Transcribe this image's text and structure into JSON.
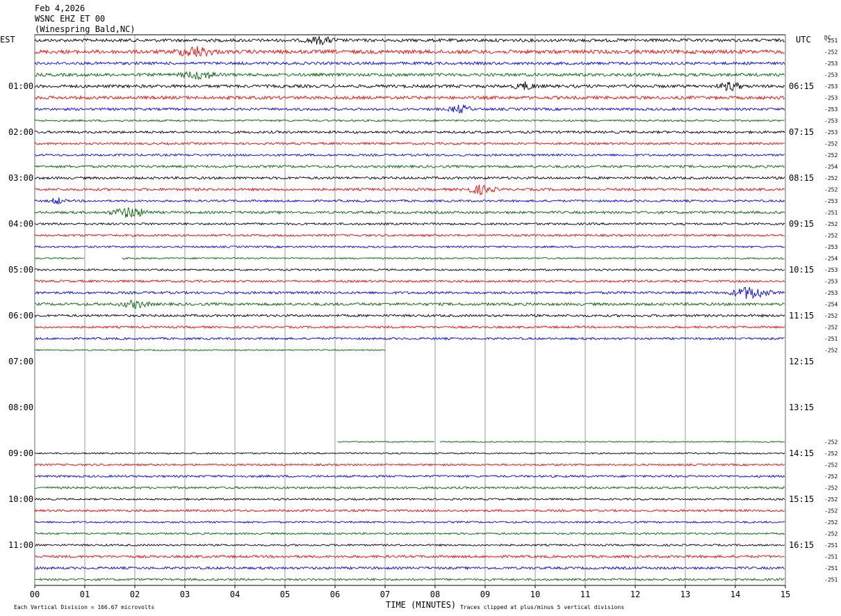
{
  "header": {
    "date": "Feb 4,2026",
    "station": "WSNC EHZ ET 00",
    "location": "(Winespring Bald,NC)"
  },
  "labels": {
    "left_zone": "EST",
    "right_zone": "UTC",
    "dc_header": "DC",
    "x_title": "TIME (MINUTES)",
    "scale_note": "Each Vertical Division =  166.67 microvolts",
    "clip_note": "Traces clipped at plus/minus 5 vertical divisions"
  },
  "colors": {
    "cycle": [
      "#000000",
      "#ff0000",
      "#0000ff",
      "#006400"
    ],
    "grid": "#808080"
  },
  "chart_data": {
    "type": "line",
    "title": "Feb 4,2026",
    "xlabel": "TIME (MINUTES)",
    "ylabel": "",
    "xlim": [
      0,
      15
    ],
    "x_ticks": [
      "00",
      "01",
      "02",
      "03",
      "04",
      "05",
      "06",
      "07",
      "08",
      "09",
      "10",
      "11",
      "12",
      "13",
      "14",
      "15"
    ],
    "left_hour_labels": [
      "01:00",
      "02:00",
      "03:00",
      "04:00",
      "05:00",
      "06:00",
      "07:00",
      "08:00",
      "09:00",
      "10:00",
      "11:00"
    ],
    "right_hour_labels": [
      "06:15",
      "07:15",
      "08:15",
      "09:15",
      "10:15",
      "11:15",
      "12:15",
      "13:15",
      "14:15",
      "15:15",
      "16:15"
    ],
    "row_count": 48,
    "rows_per_hour": 4,
    "dc_offsets": [
      "-251",
      "-252",
      "-253",
      "-253",
      "-253",
      "-253",
      "-253",
      "-253",
      "-253",
      "-252",
      "-252",
      "-254",
      "-252",
      "-252",
      "-253",
      "-251",
      "-252",
      "-252",
      "-253",
      "-254",
      "-253",
      "-253",
      "-253",
      "-254",
      "-252",
      "-252",
      "-251",
      "-252",
      "",
      "",
      "",
      "",
      "",
      "",
      "",
      "-252",
      "-252",
      "-252",
      "-252",
      "-252",
      "-252",
      "-252",
      "-252",
      "-252",
      "-251",
      "-251",
      "-251",
      "-251"
    ],
    "row_data_ranges": [
      [
        [
          0,
          15
        ]
      ],
      [
        [
          0,
          15
        ]
      ],
      [
        [
          0,
          15
        ]
      ],
      [
        [
          0,
          15
        ]
      ],
      [
        [
          0,
          15
        ]
      ],
      [
        [
          0,
          15
        ]
      ],
      [
        [
          0,
          15
        ]
      ],
      [
        [
          0,
          15
        ]
      ],
      [
        [
          0,
          15
        ]
      ],
      [
        [
          0,
          15
        ]
      ],
      [
        [
          0,
          15
        ]
      ],
      [
        [
          0,
          15
        ]
      ],
      [
        [
          0,
          15
        ]
      ],
      [
        [
          0,
          15
        ]
      ],
      [
        [
          0,
          15
        ]
      ],
      [
        [
          0,
          15
        ]
      ],
      [
        [
          0,
          15
        ]
      ],
      [
        [
          0,
          15
        ]
      ],
      [
        [
          0,
          15
        ]
      ],
      [
        [
          0,
          1
        ],
        [
          1.75,
          15
        ]
      ],
      [
        [
          0,
          15
        ]
      ],
      [
        [
          0,
          15
        ]
      ],
      [
        [
          0,
          15
        ]
      ],
      [
        [
          0,
          15
        ]
      ],
      [
        [
          0,
          15
        ]
      ],
      [
        [
          0,
          15
        ]
      ],
      [
        [
          0,
          15
        ]
      ],
      [
        [
          0,
          7
        ]
      ],
      [],
      [],
      [],
      [],
      [],
      [],
      [],
      [
        [
          6.05,
          8
        ],
        [
          8.1,
          15
        ]
      ],
      [
        [
          0,
          15
        ]
      ],
      [
        [
          0,
          15
        ]
      ],
      [
        [
          0,
          15
        ]
      ],
      [
        [
          0,
          15
        ]
      ],
      [
        [
          0,
          15
        ]
      ],
      [
        [
          0,
          15
        ]
      ],
      [
        [
          0,
          15
        ]
      ],
      [
        [
          0,
          15
        ]
      ],
      [
        [
          0,
          15
        ]
      ],
      [
        [
          0,
          15
        ]
      ],
      [
        [
          0,
          15
        ]
      ],
      [
        [
          0,
          15
        ]
      ]
    ],
    "row_amplitudes": [
      1.0,
      1.2,
      0.9,
      1.0,
      1.0,
      1.0,
      0.8,
      0.6,
      0.8,
      0.7,
      0.7,
      0.8,
      0.8,
      0.8,
      0.7,
      0.8,
      0.7,
      0.7,
      0.6,
      0.5,
      0.6,
      0.7,
      0.8,
      0.9,
      0.8,
      0.7,
      0.7,
      0.4,
      0,
      0,
      0,
      0,
      0,
      0,
      0,
      0.4,
      0.5,
      0.6,
      0.7,
      0.7,
      0.6,
      0.7,
      0.6,
      0.6,
      0.6,
      0.8,
      0.8,
      0.7
    ],
    "events": [
      {
        "row": 1,
        "minute": 3.2,
        "strength": 2.4,
        "width": 0.5
      },
      {
        "row": 0,
        "minute": 5.7,
        "strength": 1.6,
        "width": 0.4
      },
      {
        "row": 3,
        "minute": 3.3,
        "strength": 1.8,
        "width": 0.5
      },
      {
        "row": 4,
        "minute": 9.8,
        "strength": 1.6,
        "width": 0.3
      },
      {
        "row": 4,
        "minute": 13.9,
        "strength": 2.0,
        "width": 0.3
      },
      {
        "row": 6,
        "minute": 8.5,
        "strength": 1.8,
        "width": 0.3
      },
      {
        "row": 13,
        "minute": 8.9,
        "strength": 2.0,
        "width": 0.4
      },
      {
        "row": 14,
        "minute": 0.45,
        "strength": 1.6,
        "width": 0.2
      },
      {
        "row": 15,
        "minute": 1.9,
        "strength": 2.4,
        "width": 0.5
      },
      {
        "row": 22,
        "minute": 14.3,
        "strength": 3.0,
        "width": 0.5
      },
      {
        "row": 23,
        "minute": 2.0,
        "strength": 1.6,
        "width": 0.4
      }
    ]
  }
}
